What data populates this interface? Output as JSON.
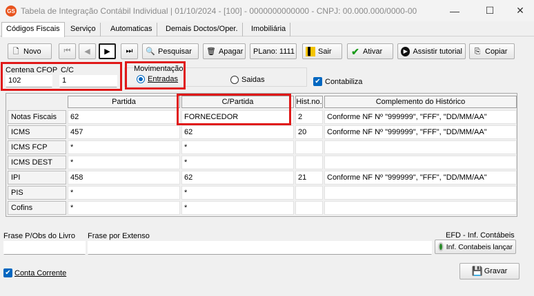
{
  "window": {
    "title": "Tabela de Integração Contábil Individual  |  01/10/2024 - [100] - 0000000000000 - CNPJ: 00.000.000/0000-00",
    "app_icon_text": "GS",
    "minimize": "—",
    "maximize": "☐",
    "close": "✕"
  },
  "tabs": [
    "Códigos Fiscais",
    "Serviço",
    "Automaticas",
    "Demais Doctos/Oper.",
    "Imobiliária"
  ],
  "toolbar": {
    "novo": "Novo",
    "pesquisar": "Pesquisar",
    "apagar": "Apagar",
    "plano": "PLano: 1111",
    "sair": "Sair",
    "ativar": "Ativar",
    "assistir": "Assistir tutorial",
    "copiar": "Copiar",
    "nav_first": "⏮",
    "nav_prev": "◀",
    "nav_next": "▶",
    "nav_last": "⏭"
  },
  "header": {
    "centena_label": "Centena CFOP",
    "centena_value": "102",
    "cc_label": "C/C",
    "cc_value": "1",
    "movimentacao_label": "Movimentação",
    "entradas": "Entradas",
    "saidas": "Saidas",
    "contabiliza": "Contabiliza"
  },
  "grid": {
    "columns": [
      "Partida",
      "C/Partida",
      "Hist.no.",
      "Complemento do Histórico"
    ],
    "rows": [
      {
        "label": "Notas Fiscais",
        "partida": "62",
        "cpartida": "FORNECEDOR",
        "hist": "2",
        "comp": "Conforme NF Nº \"999999\", \"FFF\", \"DD/MM/AA\""
      },
      {
        "label": "ICMS",
        "partida": "457",
        "cpartida": "62",
        "hist": "20",
        "comp": "Conforme NF Nº \"999999\", \"FFF\", \"DD/MM/AA\""
      },
      {
        "label": "ICMS FCP",
        "partida": "*",
        "cpartida": "*",
        "hist": "",
        "comp": ""
      },
      {
        "label": "ICMS DEST",
        "partida": "*",
        "cpartida": "*",
        "hist": "",
        "comp": ""
      },
      {
        "label": "IPI",
        "partida": "458",
        "cpartida": "62",
        "hist": "21",
        "comp": "Conforme NF Nº \"999999\", \"FFF\", \"DD/MM/AA\""
      },
      {
        "label": "PIS",
        "partida": "*",
        "cpartida": "*",
        "hist": "",
        "comp": ""
      },
      {
        "label": "Cofins",
        "partida": "*",
        "cpartida": "*",
        "hist": "",
        "comp": ""
      }
    ]
  },
  "footer": {
    "frase_obs_label": "Frase P/Obs do Livro",
    "frase_obs_value": "",
    "frase_extenso_label": "Frase por Extenso",
    "frase_extenso_value": "",
    "efd_label": "EFD - Inf. Contábeis",
    "efd_button": "Inf. Contabeis lançar",
    "conta_corrente": "Conta Corrente",
    "gravar": "Gravar"
  },
  "colors": {
    "highlight": "#e01818",
    "accent": "#0067c0"
  }
}
